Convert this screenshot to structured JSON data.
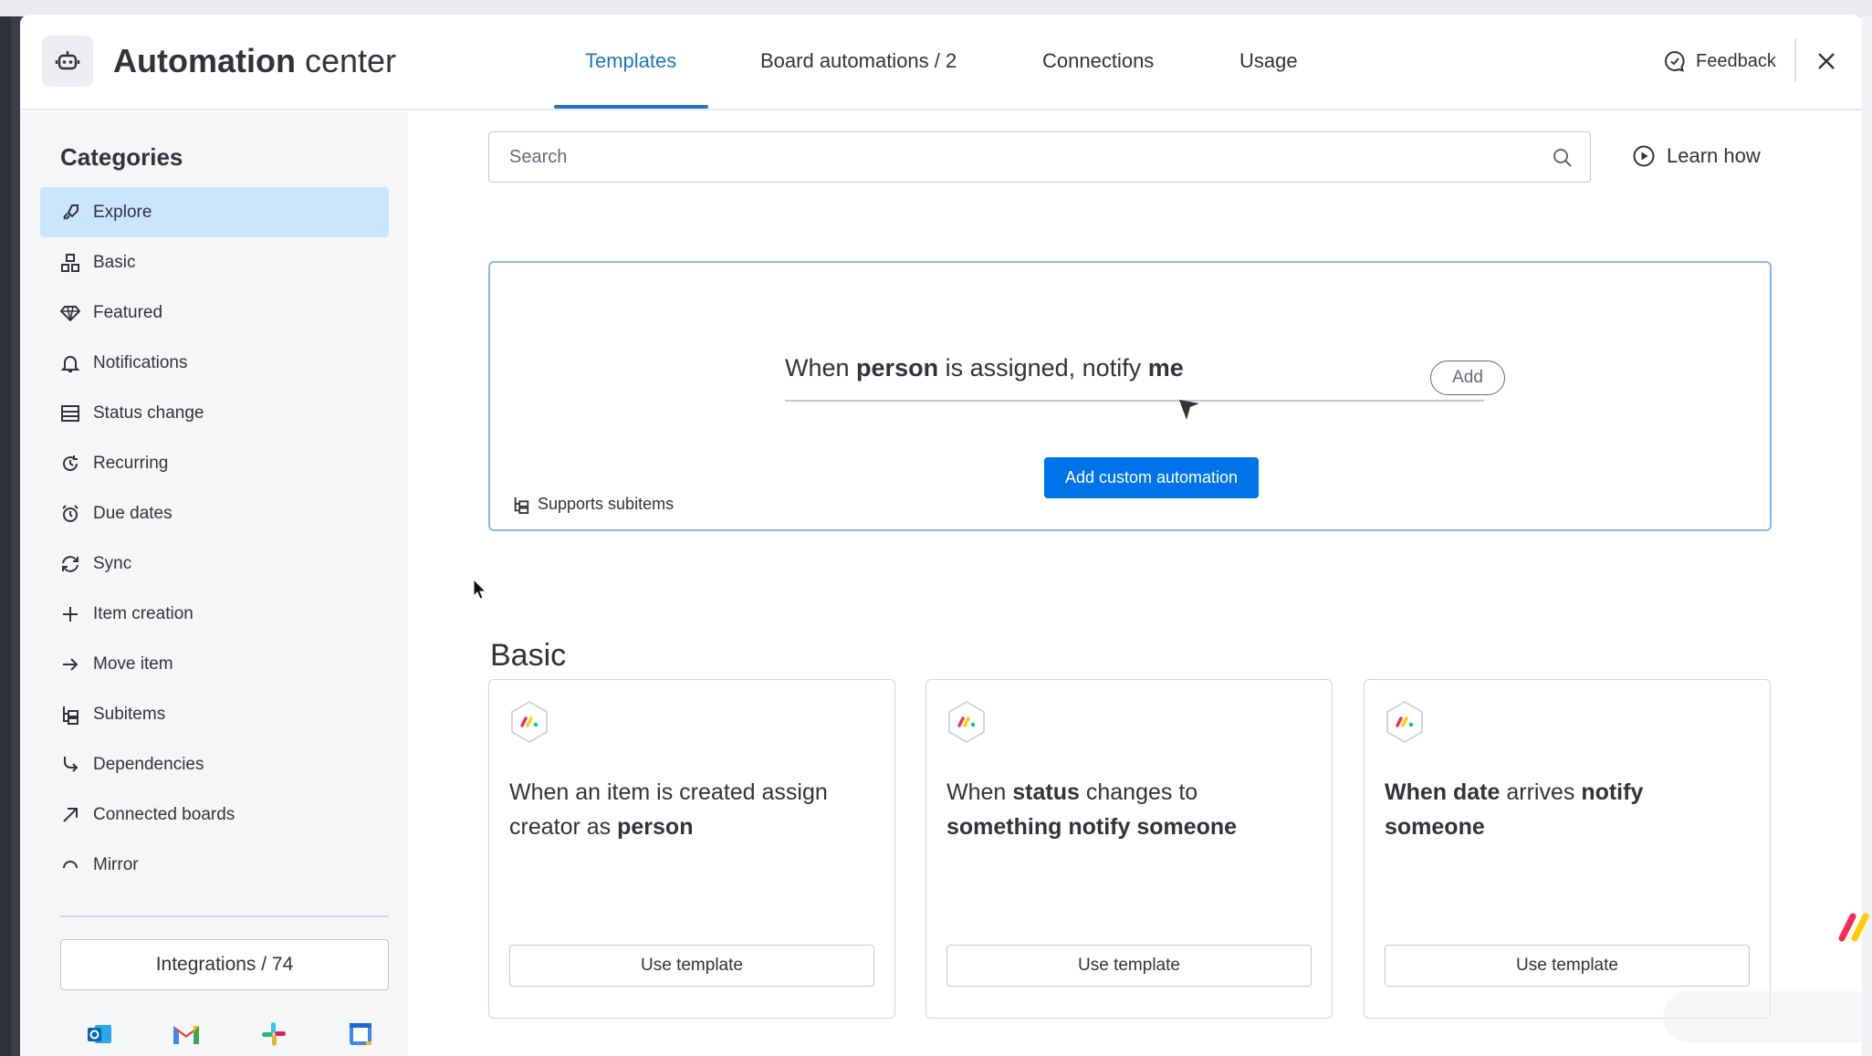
{
  "header": {
    "title_bold": "Automation",
    "title_light": "center",
    "tabs": [
      {
        "label": "Templates",
        "active": true
      },
      {
        "label": "Board automations / 2",
        "active": false
      },
      {
        "label": "Connections",
        "active": false
      },
      {
        "label": "Usage",
        "active": false
      }
    ],
    "feedback_label": "Feedback",
    "accent_color": "#1f76c2"
  },
  "sidebar": {
    "title": "Categories",
    "items": [
      {
        "label": "Explore",
        "icon": "rocket-icon",
        "active": true
      },
      {
        "label": "Basic",
        "icon": "shapes-icon",
        "active": false
      },
      {
        "label": "Featured",
        "icon": "diamond-icon",
        "active": false
      },
      {
        "label": "Notifications",
        "icon": "bell-icon",
        "active": false
      },
      {
        "label": "Status change",
        "icon": "status-icon",
        "active": false
      },
      {
        "label": "Recurring",
        "icon": "recurring-icon",
        "active": false
      },
      {
        "label": "Due dates",
        "icon": "alarm-icon",
        "active": false
      },
      {
        "label": "Sync",
        "icon": "sync-icon",
        "active": false
      },
      {
        "label": "Item creation",
        "icon": "plus-icon",
        "active": false
      },
      {
        "label": "Move item",
        "icon": "arrow-right-icon",
        "active": false
      },
      {
        "label": "Subitems",
        "icon": "subitems-icon",
        "active": false
      },
      {
        "label": "Dependencies",
        "icon": "dependency-icon",
        "active": false
      },
      {
        "label": "Connected boards",
        "icon": "arrow-up-right-icon",
        "active": false
      },
      {
        "label": "Mirror",
        "icon": "mirror-icon",
        "active": false
      }
    ],
    "integrations_label": "Integrations / 74",
    "integration_apps": [
      "outlook-icon",
      "gmail-icon",
      "slack-icon",
      "google-calendar-icon"
    ]
  },
  "search": {
    "placeholder": "Search",
    "value": ""
  },
  "learn_how_label": "Learn how",
  "custom": {
    "sentence_parts": [
      "When ",
      "person",
      " is assigned, notify ",
      "me"
    ],
    "add_label": "Add",
    "add_custom_label": "Add custom automation",
    "supports_subitems_label": "Supports subitems",
    "button_color": "#0073ea"
  },
  "basic": {
    "title": "Basic",
    "cards": [
      {
        "parts": [
          [
            "When an item is created assign creator as ",
            false
          ],
          [
            "person",
            true
          ]
        ],
        "use_label": "Use template"
      },
      {
        "parts": [
          [
            "When ",
            false
          ],
          [
            "status",
            true
          ],
          [
            " changes to ",
            false
          ],
          [
            "something notify someone",
            true
          ]
        ],
        "use_label": "Use template"
      },
      {
        "parts": [
          [
            "When date",
            true
          ],
          [
            " arrives ",
            false
          ],
          [
            "notify someone",
            true
          ]
        ],
        "use_label": "Use template"
      }
    ]
  }
}
